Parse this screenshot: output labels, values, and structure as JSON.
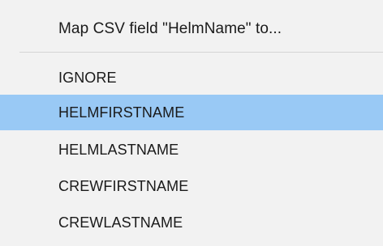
{
  "menu": {
    "header": "Map CSV field \"HelmName\" to...",
    "items": [
      {
        "label": "IGNORE"
      },
      {
        "label": "HELMFIRSTNAME",
        "selected": true
      },
      {
        "label": "HELMLASTNAME"
      },
      {
        "label": "CREWFIRSTNAME"
      },
      {
        "label": "CREWLASTNAME"
      }
    ]
  },
  "colors": {
    "menu_background": "#f2f2f2",
    "selected_highlight": "#99c9f5",
    "separator": "#d4d4d4",
    "text": "#1a1a1a"
  }
}
